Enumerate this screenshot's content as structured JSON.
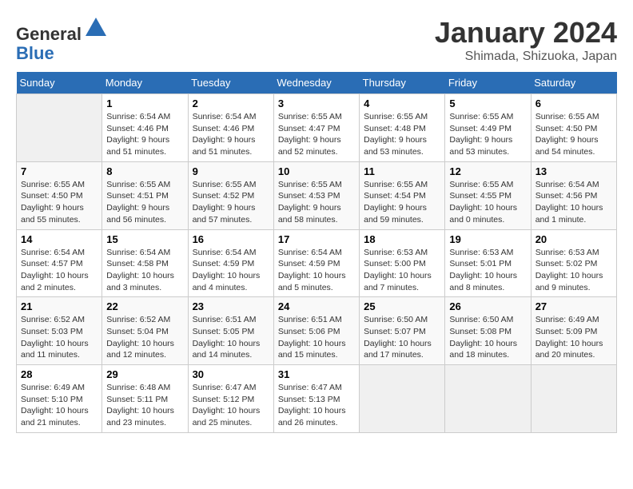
{
  "header": {
    "logo_line1": "General",
    "logo_line2": "Blue",
    "title": "January 2024",
    "subtitle": "Shimada, Shizuoka, Japan"
  },
  "days_of_week": [
    "Sunday",
    "Monday",
    "Tuesday",
    "Wednesday",
    "Thursday",
    "Friday",
    "Saturday"
  ],
  "weeks": [
    [
      {
        "day": "",
        "info": ""
      },
      {
        "day": "1",
        "info": "Sunrise: 6:54 AM\nSunset: 4:46 PM\nDaylight: 9 hours\nand 51 minutes."
      },
      {
        "day": "2",
        "info": "Sunrise: 6:54 AM\nSunset: 4:46 PM\nDaylight: 9 hours\nand 51 minutes."
      },
      {
        "day": "3",
        "info": "Sunrise: 6:55 AM\nSunset: 4:47 PM\nDaylight: 9 hours\nand 52 minutes."
      },
      {
        "day": "4",
        "info": "Sunrise: 6:55 AM\nSunset: 4:48 PM\nDaylight: 9 hours\nand 53 minutes."
      },
      {
        "day": "5",
        "info": "Sunrise: 6:55 AM\nSunset: 4:49 PM\nDaylight: 9 hours\nand 53 minutes."
      },
      {
        "day": "6",
        "info": "Sunrise: 6:55 AM\nSunset: 4:50 PM\nDaylight: 9 hours\nand 54 minutes."
      }
    ],
    [
      {
        "day": "7",
        "info": "Sunrise: 6:55 AM\nSunset: 4:50 PM\nDaylight: 9 hours\nand 55 minutes."
      },
      {
        "day": "8",
        "info": "Sunrise: 6:55 AM\nSunset: 4:51 PM\nDaylight: 9 hours\nand 56 minutes."
      },
      {
        "day": "9",
        "info": "Sunrise: 6:55 AM\nSunset: 4:52 PM\nDaylight: 9 hours\nand 57 minutes."
      },
      {
        "day": "10",
        "info": "Sunrise: 6:55 AM\nSunset: 4:53 PM\nDaylight: 9 hours\nand 58 minutes."
      },
      {
        "day": "11",
        "info": "Sunrise: 6:55 AM\nSunset: 4:54 PM\nDaylight: 9 hours\nand 59 minutes."
      },
      {
        "day": "12",
        "info": "Sunrise: 6:55 AM\nSunset: 4:55 PM\nDaylight: 10 hours\nand 0 minutes."
      },
      {
        "day": "13",
        "info": "Sunrise: 6:54 AM\nSunset: 4:56 PM\nDaylight: 10 hours\nand 1 minute."
      }
    ],
    [
      {
        "day": "14",
        "info": "Sunrise: 6:54 AM\nSunset: 4:57 PM\nDaylight: 10 hours\nand 2 minutes."
      },
      {
        "day": "15",
        "info": "Sunrise: 6:54 AM\nSunset: 4:58 PM\nDaylight: 10 hours\nand 3 minutes."
      },
      {
        "day": "16",
        "info": "Sunrise: 6:54 AM\nSunset: 4:59 PM\nDaylight: 10 hours\nand 4 minutes."
      },
      {
        "day": "17",
        "info": "Sunrise: 6:54 AM\nSunset: 4:59 PM\nDaylight: 10 hours\nand 5 minutes."
      },
      {
        "day": "18",
        "info": "Sunrise: 6:53 AM\nSunset: 5:00 PM\nDaylight: 10 hours\nand 7 minutes."
      },
      {
        "day": "19",
        "info": "Sunrise: 6:53 AM\nSunset: 5:01 PM\nDaylight: 10 hours\nand 8 minutes."
      },
      {
        "day": "20",
        "info": "Sunrise: 6:53 AM\nSunset: 5:02 PM\nDaylight: 10 hours\nand 9 minutes."
      }
    ],
    [
      {
        "day": "21",
        "info": "Sunrise: 6:52 AM\nSunset: 5:03 PM\nDaylight: 10 hours\nand 11 minutes."
      },
      {
        "day": "22",
        "info": "Sunrise: 6:52 AM\nSunset: 5:04 PM\nDaylight: 10 hours\nand 12 minutes."
      },
      {
        "day": "23",
        "info": "Sunrise: 6:51 AM\nSunset: 5:05 PM\nDaylight: 10 hours\nand 14 minutes."
      },
      {
        "day": "24",
        "info": "Sunrise: 6:51 AM\nSunset: 5:06 PM\nDaylight: 10 hours\nand 15 minutes."
      },
      {
        "day": "25",
        "info": "Sunrise: 6:50 AM\nSunset: 5:07 PM\nDaylight: 10 hours\nand 17 minutes."
      },
      {
        "day": "26",
        "info": "Sunrise: 6:50 AM\nSunset: 5:08 PM\nDaylight: 10 hours\nand 18 minutes."
      },
      {
        "day": "27",
        "info": "Sunrise: 6:49 AM\nSunset: 5:09 PM\nDaylight: 10 hours\nand 20 minutes."
      }
    ],
    [
      {
        "day": "28",
        "info": "Sunrise: 6:49 AM\nSunset: 5:10 PM\nDaylight: 10 hours\nand 21 minutes."
      },
      {
        "day": "29",
        "info": "Sunrise: 6:48 AM\nSunset: 5:11 PM\nDaylight: 10 hours\nand 23 minutes."
      },
      {
        "day": "30",
        "info": "Sunrise: 6:47 AM\nSunset: 5:12 PM\nDaylight: 10 hours\nand 25 minutes."
      },
      {
        "day": "31",
        "info": "Sunrise: 6:47 AM\nSunset: 5:13 PM\nDaylight: 10 hours\nand 26 minutes."
      },
      {
        "day": "",
        "info": ""
      },
      {
        "day": "",
        "info": ""
      },
      {
        "day": "",
        "info": ""
      }
    ]
  ]
}
